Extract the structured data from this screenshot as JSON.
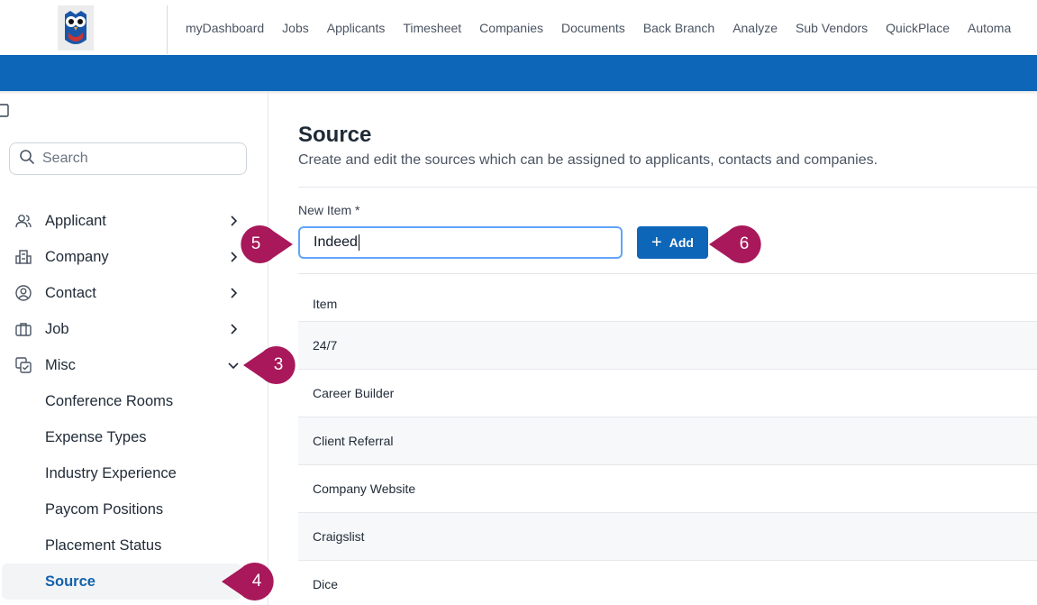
{
  "nav": {
    "items": [
      "myDashboard",
      "Jobs",
      "Applicants",
      "Timesheet",
      "Companies",
      "Documents",
      "Back Branch",
      "Analyze",
      "Sub Vendors",
      "QuickPlace",
      "Automa"
    ]
  },
  "sidebar": {
    "search_placeholder": "Search",
    "menu": [
      {
        "label": "Applicant",
        "icon": "users-icon"
      },
      {
        "label": "Company",
        "icon": "building-icon"
      },
      {
        "label": "Contact",
        "icon": "contact-icon"
      },
      {
        "label": "Job",
        "icon": "briefcase-icon"
      },
      {
        "label": "Misc",
        "icon": "misc-icon",
        "expanded": true
      }
    ],
    "misc_items": [
      "Conference Rooms",
      "Expense Types",
      "Industry Experience",
      "Paycom Positions",
      "Placement Status",
      "Source"
    ],
    "active_item": "Source"
  },
  "main": {
    "title": "Source",
    "subtitle": "Create and edit the sources which can be assigned to applicants, contacts and companies.",
    "new_item_label": "New Item *",
    "new_item_value": "Indeed",
    "add_label": "Add",
    "table_header": "Item",
    "rows": [
      "24/7",
      "Career Builder",
      "Client Referral",
      "Company Website",
      "Craigslist",
      "Dice"
    ]
  },
  "callouts": [
    "3",
    "4",
    "5",
    "6"
  ],
  "colors": {
    "brand_blue": "#0d66b8",
    "callout": "#a8185a",
    "active_text": "#1262ad",
    "input_focus": "#60a5fa"
  }
}
